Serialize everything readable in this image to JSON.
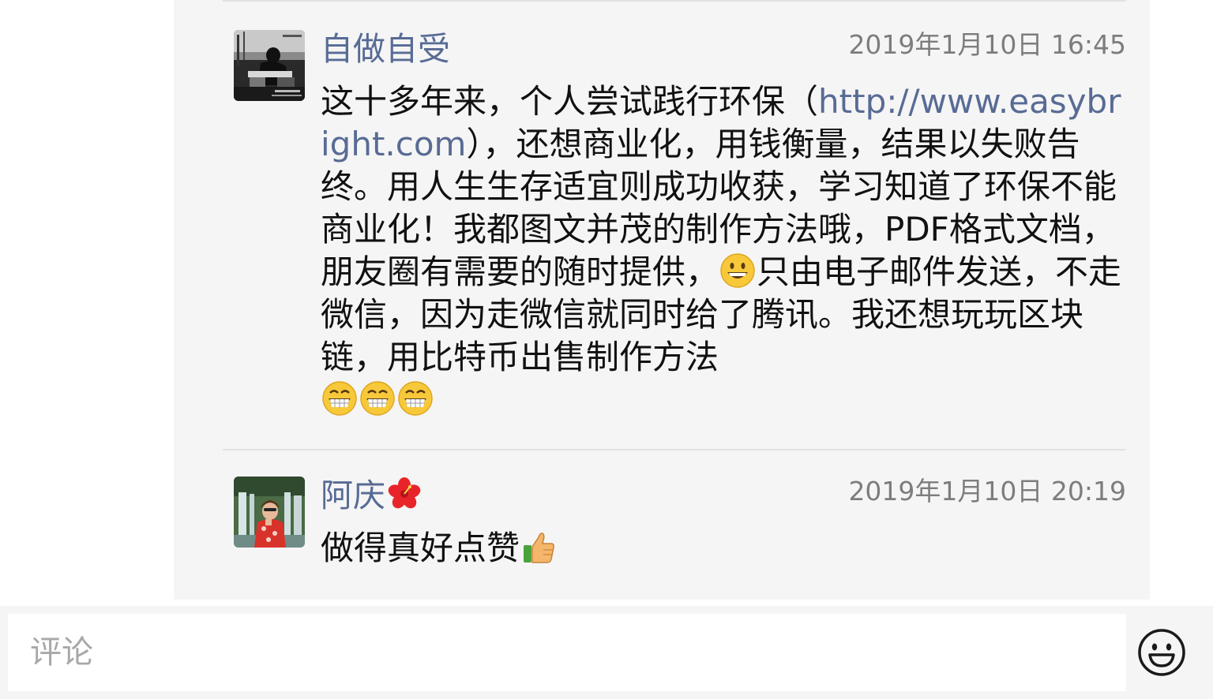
{
  "comments": [
    {
      "author": "自做自受",
      "timestamp": "2019年1月10日 16:45",
      "avatar_icon": "author-photo-grayscale",
      "text_before_link": "这十多年来，个人尝试践行环保（",
      "link": "http://www.easybright.com",
      "text_after_link": "），还想商业化，用钱衡量，结果以失败告终。用人生生存适宜则成功收获，学习知道了环保不能商业化！我都图文并茂的制作方法哦，PDF格式文档，朋友圈有需要的随时提供，",
      "emoji_1": "grinning-face",
      "text_after_emoji": "只由电子邮件发送，不走微信，因为走微信就同时给了腾讯。我还想玩玩区块链，用比特币出售制作方法",
      "trailing_emojis": [
        "grinning-squinting-face",
        "grinning-squinting-face",
        "grinning-squinting-face"
      ]
    },
    {
      "author": "阿庆",
      "author_emoji": "hibiscus",
      "timestamp": "2019年1月10日 20:19",
      "avatar_icon": "author-photo-waterfall",
      "text": "做得真好点赞",
      "trailing_emoji": "thumbs-up"
    }
  ],
  "input": {
    "placeholder": "评论",
    "value": "",
    "emoji_button_icon": "smiley-face-icon"
  },
  "colors": {
    "link": "#586b95",
    "author": "#586b95",
    "timestamp": "#7d7d7d",
    "text": "#111111",
    "panel_bg": "#f5f5f5",
    "placeholder": "#a8a8a8"
  }
}
